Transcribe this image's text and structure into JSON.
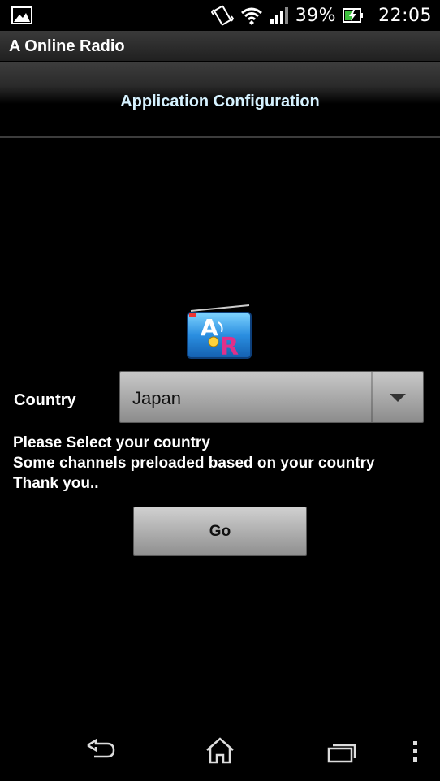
{
  "status_bar": {
    "battery_percent": "39%",
    "time": "22:05",
    "icons": [
      "picture-notification-icon",
      "vibrate-icon",
      "wifi-icon",
      "signal-icon",
      "battery-charging-icon"
    ]
  },
  "action_bar": {
    "title": "A Online Radio"
  },
  "config": {
    "heading": "Application Configuration"
  },
  "logo": {
    "letters": "AR"
  },
  "form": {
    "country_label": "Country",
    "country_value": "Japan",
    "info_lines": [
      "Please Select your country",
      "Some channels preloaded based on your country",
      "Thank you.."
    ],
    "go_label": "Go"
  },
  "nav_bar": {
    "icons": [
      "back-icon",
      "home-icon",
      "recent-apps-icon",
      "overflow-menu-icon"
    ]
  },
  "colors": {
    "background": "#000000",
    "heading_text": "#d6f2ff",
    "button_face": "#b8b8b8"
  }
}
